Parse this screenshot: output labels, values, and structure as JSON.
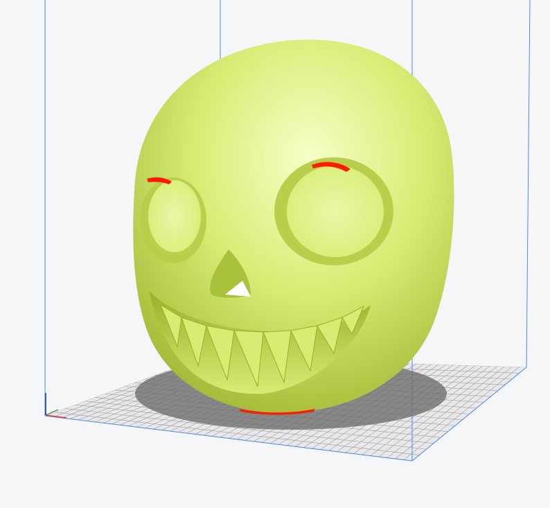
{
  "viewport": {
    "background": "#f4f6f8",
    "build_volume_color": "#4a86e8",
    "plate_fill": "#e8e8ea",
    "plate_grid_color": "#9a9a9a",
    "shadow_color": "#6e6e6e"
  },
  "model": {
    "name": "skull-model",
    "body_color": "#d7ec73",
    "highlight_color": "#f6ffc8",
    "shade_color": "#97b02a",
    "overhang_color": "#ff1a00"
  },
  "axes": {
    "x_color": "#e53935",
    "y_color": "#43a047",
    "z_color": "#1e3a8a"
  }
}
